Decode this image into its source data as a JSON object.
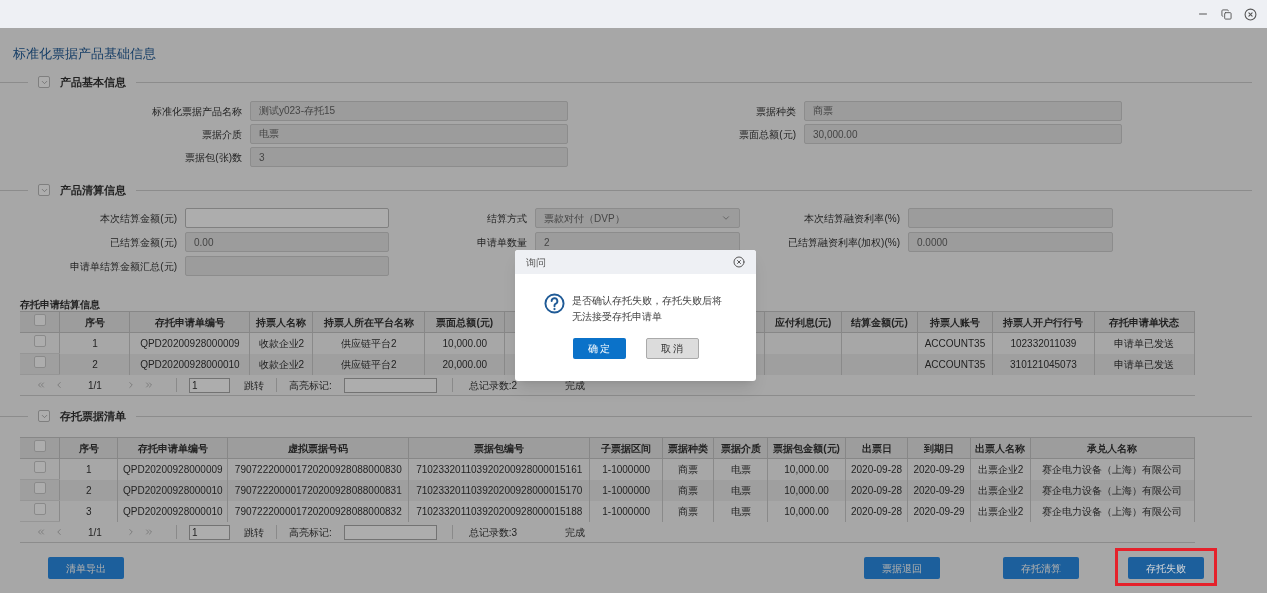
{
  "page_title": "标准化票据产品基础信息",
  "basic_section": {
    "title": "产品基本信息",
    "expanded": true,
    "rows": [
      [
        {
          "label": "标准化票据产品名称",
          "value": "测试y023-存托15",
          "disabled": true
        },
        {
          "label": "票据种类",
          "value": "商票",
          "disabled": true
        }
      ],
      [
        {
          "label": "票据介质",
          "value": "电票",
          "disabled": true
        },
        {
          "label": "票面总额(元)",
          "value": "30,000.00",
          "disabled": true
        }
      ],
      [
        {
          "label": "票据包(张)数",
          "value": "3",
          "disabled": true
        }
      ]
    ]
  },
  "clearing_section": {
    "title": "产品清算信息",
    "expanded": true,
    "rows": [
      [
        {
          "kind": "input",
          "label": "本次结算金额(元)",
          "disabled": false
        },
        {
          "kind": "select",
          "label": "结算方式",
          "value": "票款对付（DVP）",
          "disabled": true
        },
        {
          "kind": "input",
          "label": "本次结算融资利率(%)",
          "disabled": true
        }
      ],
      [
        {
          "kind": "input",
          "label": "已结算金额(元)",
          "value": "0.00",
          "disabled": true
        },
        {
          "kind": "input",
          "label": "申请单数量",
          "value": "2",
          "disabled": true
        },
        {
          "kind": "input",
          "label": "已结算融资利率(加权)(%)",
          "value": "0.0000",
          "disabled": true
        }
      ],
      [
        {
          "kind": "input",
          "label": "申请单结算金额汇总(元)",
          "disabled": true
        }
      ]
    ]
  },
  "requests_table": {
    "title": "存托申请结算信息",
    "header_checked": false,
    "columns": [
      "序号",
      "存托申请单编号",
      "持票人名称",
      "持票人所在平台名称",
      "票面总额(元)",
      null,
      "应付利息(元)",
      "结算金额(元)",
      "持票人账号",
      "持票人开户行行号",
      "存托申请单状态"
    ],
    "rows": [
      {
        "checked": false,
        "cells": [
          "1",
          "QPD20200928000009",
          "收款企业2",
          "供应链平台2",
          "10,000.00",
          null,
          null,
          null,
          "ACCOUNT35",
          "102332011039",
          "申请单已发送"
        ]
      },
      {
        "checked": false,
        "cells": [
          "2",
          "QPD20200928000010",
          "收款企业2",
          "供应链平台2",
          "20,000.00",
          null,
          null,
          null,
          "ACCOUNT35",
          "310121045073",
          "申请单已发送"
        ]
      }
    ],
    "pager": {
      "page": "1/1",
      "jump_value": "1",
      "jump_label": "跳转",
      "highlight_label": "高亮标记:",
      "total": "总记录数:2",
      "status": "完成"
    }
  },
  "bills_section": {
    "title": "存托票据清单",
    "expanded": true
  },
  "bills_table": {
    "header_checked": false,
    "columns": [
      "序号",
      "存托申请单编号",
      "虚拟票据号码",
      "票据包编号",
      "子票据区间",
      "票据种类",
      "票据介质",
      "票据包金额(元)",
      "出票日",
      "到期日",
      "出票人名称",
      "承兑人名称"
    ],
    "rows": [
      {
        "checked": false,
        "cells": [
          "1",
          "QPD20200928000009",
          "790722200001720200928088000830",
          "710233201103920200928000015161",
          "1-1000000",
          "商票",
          "电票",
          "10,000.00",
          "2020-09-28",
          "2020-09-29",
          "出票企业2",
          "赛企电力设备（上海）有限公司"
        ]
      },
      {
        "checked": false,
        "cells": [
          "2",
          "QPD20200928000010",
          "790722200001720200928088000831",
          "710233201103920200928000015170",
          "1-1000000",
          "商票",
          "电票",
          "10,000.00",
          "2020-09-28",
          "2020-09-29",
          "出票企业2",
          "赛企电力设备（上海）有限公司"
        ]
      },
      {
        "checked": false,
        "cells": [
          "3",
          "QPD20200928000010",
          "790722200001720200928088000832",
          "710233201103920200928000015188",
          "1-1000000",
          "商票",
          "电票",
          "10,000.00",
          "2020-09-28",
          "2020-09-29",
          "出票企业2",
          "赛企电力设备（上海）有限公司"
        ]
      }
    ],
    "pager": {
      "page": "1/1",
      "jump_value": "1",
      "jump_label": "跳转",
      "highlight_label": "高亮标记:",
      "total": "总记录数:3",
      "status": "完成"
    }
  },
  "footer_buttons": [
    {
      "label": "清单导出",
      "highlighted": false
    },
    {
      "label": "票据退回",
      "highlighted": false
    },
    {
      "label": "存托清算",
      "highlighted": false
    },
    {
      "label": "存托失败",
      "highlighted": true
    }
  ],
  "dialog": {
    "title": "询问",
    "message_lines": [
      "是否确认存托失败，存托失败后将",
      "无法接受存托申请单"
    ],
    "buttons": [
      {
        "label": "确 定",
        "kind": "primary"
      },
      {
        "label": "取 消",
        "kind": "secondary"
      }
    ]
  }
}
